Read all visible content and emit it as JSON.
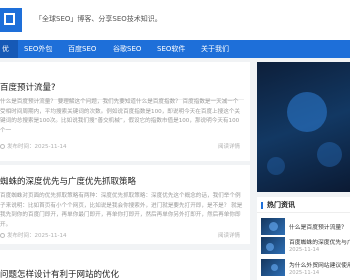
{
  "header": {
    "logo_icon": "logo-icon",
    "slogan": "「全球SEO」博客、分享SEO技术知识。"
  },
  "nav": {
    "items": [
      {
        "label": "优",
        "active": true
      },
      {
        "label": "SEO外包",
        "active": false
      },
      {
        "label": "百度SEO",
        "active": false
      },
      {
        "label": "谷歌SEO",
        "active": false
      },
      {
        "label": "SEO软件",
        "active": false
      },
      {
        "label": "关于我们",
        "active": false
      }
    ]
  },
  "articles": [
    {
      "title": "百度预计流量?",
      "excerpt": "什么是百度预计流量？ 要理解这个问题，我们先要知道什么是百度指数？ 百度指数是一天减一个受相时间周期内，平均搜索关键词的次数。例如说百度指数是100，即说明今天在百度上搜这个关键词的总搜索是100次。比如说我们搜“善交机械”，假设它的指数市值是100，那说明今天有100个一",
      "date": "发布时间：2025-11-14",
      "read": "阅读详情"
    },
    {
      "title": "蜘蛛的深度优先与广度优先抓取策略",
      "excerpt": "百度蜘蛛对页面的优先抓取策略有两种：深度优先抓取策略：深度优先这个概念的话，我们举个例子来说明：比如首页有小个个网页，比如说是我会你搜索外，进门就是要先打开即，是不是？ 就是我先到你的百度门即开，再单你最门即开，再单你打即开，然后再单你另外打即开，然后再单你即开。",
      "date": "发布时间：2025-11-14",
      "read": "阅读详情"
    },
    {
      "title": "问题怎样设计有利于网站的优化"
    }
  ],
  "sidebar": {
    "hot_title": "热门资讯",
    "hot_icon": "bar-icon",
    "items": [
      {
        "title": "什么是百度预计流量？",
        "date": "2025-11-14"
      },
      {
        "title": "百度蜘蛛的深度优先与广度...",
        "date": "2025-11-14"
      },
      {
        "title": "为什么外贸网站建议使用...",
        "date": "2025-11-14"
      }
    ]
  },
  "colors": {
    "brand": "#1e6fd9",
    "background": "#f1f3f5",
    "text": "#333333",
    "muted": "#9a9a9a"
  }
}
